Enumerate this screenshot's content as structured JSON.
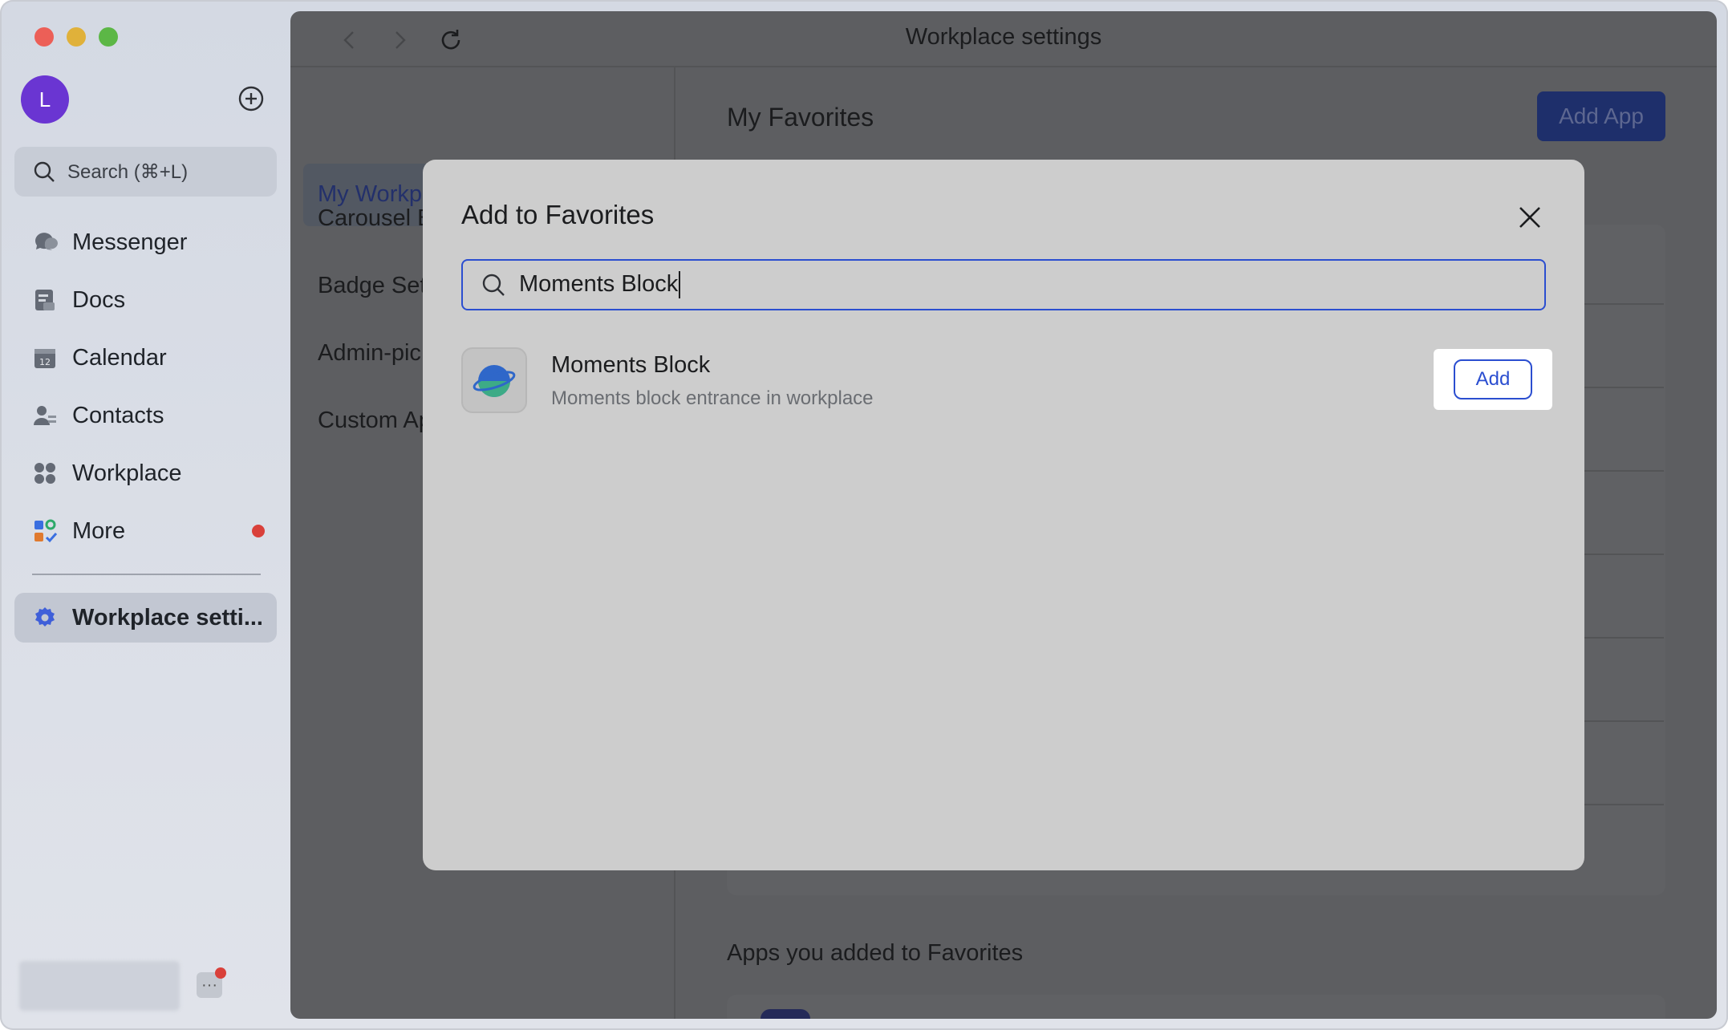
{
  "app": {
    "window_title": "Workplace settings",
    "avatar_letter": "L",
    "search_placeholder": "Search (⌘+L)"
  },
  "sidebar": {
    "items": [
      {
        "label": "Messenger",
        "icon": "messenger-icon"
      },
      {
        "label": "Docs",
        "icon": "docs-icon"
      },
      {
        "label": "Calendar",
        "icon": "calendar-icon"
      },
      {
        "label": "Contacts",
        "icon": "contacts-icon"
      },
      {
        "label": "Workplace",
        "icon": "workplace-icon"
      },
      {
        "label": "More",
        "icon": "more-apps-icon",
        "badge": true
      }
    ],
    "active_item": {
      "label": "Workplace setti...",
      "icon": "gear-icon"
    }
  },
  "settings_nav": {
    "active": "My Workplace",
    "items": [
      "Carousel B",
      "Badge Set",
      "Admin-pic",
      "Custom Ap"
    ]
  },
  "main": {
    "section_title": "My Favorites",
    "add_app_label": "Add App",
    "apps_added_title": "Apps you added to Favorites"
  },
  "modal": {
    "title": "Add to Favorites",
    "search_value": "Moments Block",
    "result": {
      "title": "Moments Block",
      "description": "Moments block entrance in workplace",
      "action_label": "Add",
      "icon": "planet-icon"
    }
  },
  "colors": {
    "accent": "#2b4ed0",
    "badge_red": "#d9403a",
    "avatar": "#6a35d2"
  }
}
